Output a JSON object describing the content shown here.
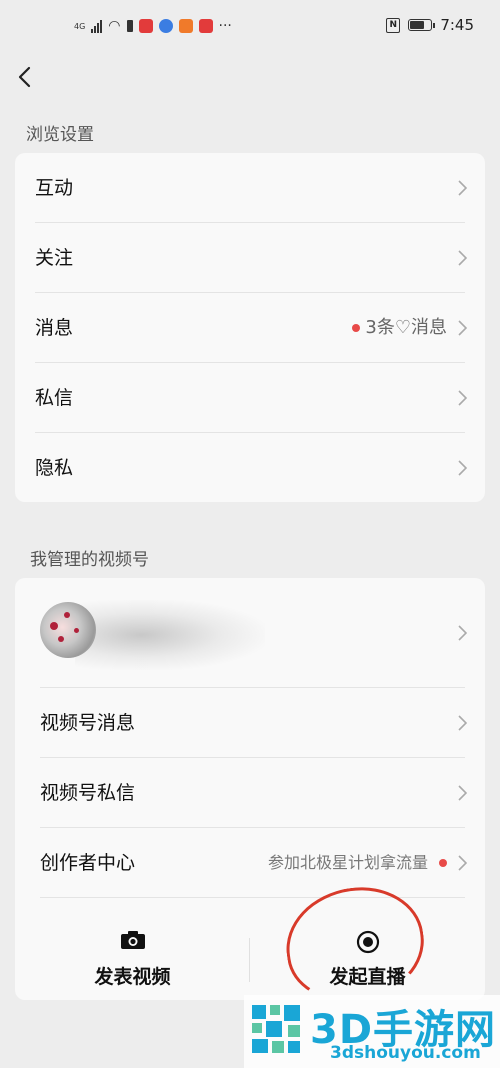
{
  "status_bar": {
    "network": "4G",
    "time": "7:45",
    "more": "···"
  },
  "browse_section": {
    "title": "浏览设置",
    "items": [
      {
        "label": "互动"
      },
      {
        "label": "关注"
      },
      {
        "label": "消息",
        "hint": "3条♡消息",
        "has_dot": true
      },
      {
        "label": "私信"
      },
      {
        "label": "隐私"
      }
    ]
  },
  "channels_section": {
    "title": "我管理的视频号",
    "items": [
      {
        "label": "视频号消息"
      },
      {
        "label": "视频号私信"
      },
      {
        "label": "创作者中心",
        "hint": "参加北极星计划拿流量",
        "has_dot": true
      }
    ],
    "actions": [
      {
        "label": "发表视频",
        "icon": "camera-icon"
      },
      {
        "label": "发起直播",
        "icon": "live-record-icon"
      }
    ]
  },
  "watermark": {
    "brand": "3D手游网",
    "domain": "3dshouyou.com"
  },
  "colors": {
    "accent_dot": "#e84a48",
    "annotation": "#d83a2a",
    "watermark": "#1aa6d6"
  }
}
